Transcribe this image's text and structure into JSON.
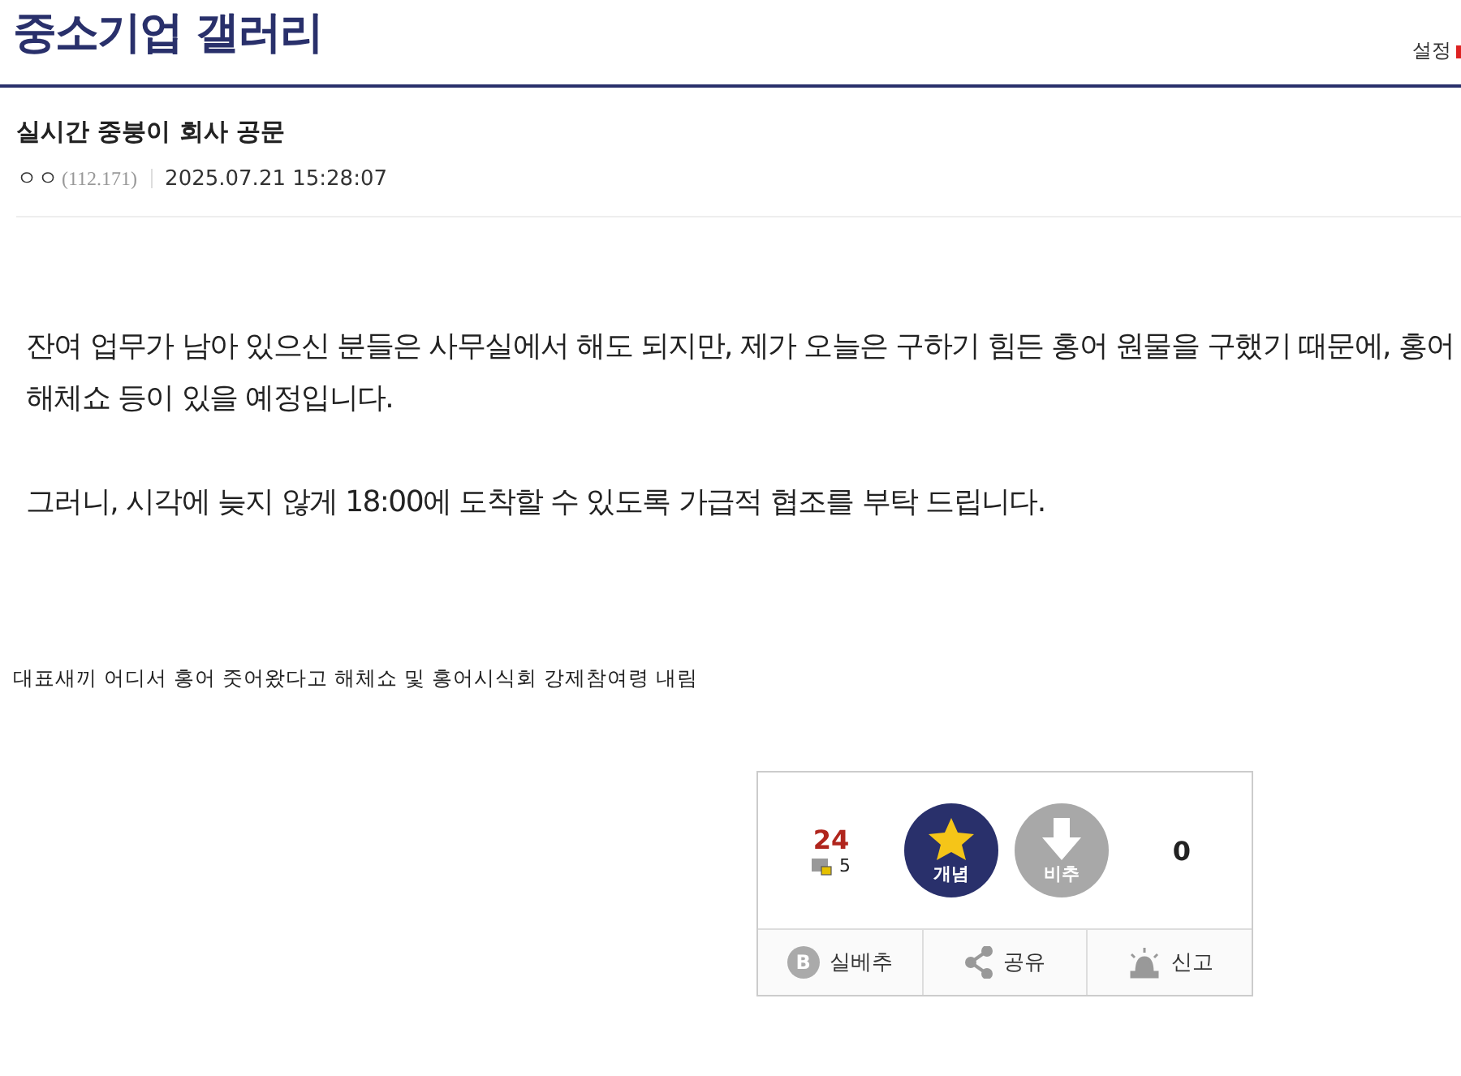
{
  "gallery": {
    "title": "중소기업 갤러리",
    "settings": "설정"
  },
  "post": {
    "title": "실시간 중붕이 회사 공문",
    "author": "ㅇㅇ",
    "ip": "(112.171)",
    "date": "2025.07.21 15:28:07"
  },
  "body": {
    "paragraphs": [
      "잔여 업무가 남아 있으신 분들은 사무실에서 해도 되지만, 제가 오늘은 구하기 힘든 홍어 원물을 구했기 때문에, 홍어 해체쇼 등이 있을 예정입니다.",
      "그러니, 시각에 늦지 않게 18:00에 도착할 수 있도록 가급적 협조를 부탁 드립니다."
    ],
    "caption": "대표새끼 어디서 홍어 줏어왔다고 해체쇼 및 홍어시식회 강제참여령 내림"
  },
  "vote": {
    "up_count": "24",
    "fixed_count": "5",
    "up_label": "개념",
    "down_label": "비추",
    "down_count": "0"
  },
  "actions": [
    {
      "kind": "best",
      "icon_letter": "B",
      "label": "실베추"
    },
    {
      "kind": "share",
      "label": "공유"
    },
    {
      "kind": "report",
      "label": "신고"
    }
  ]
}
